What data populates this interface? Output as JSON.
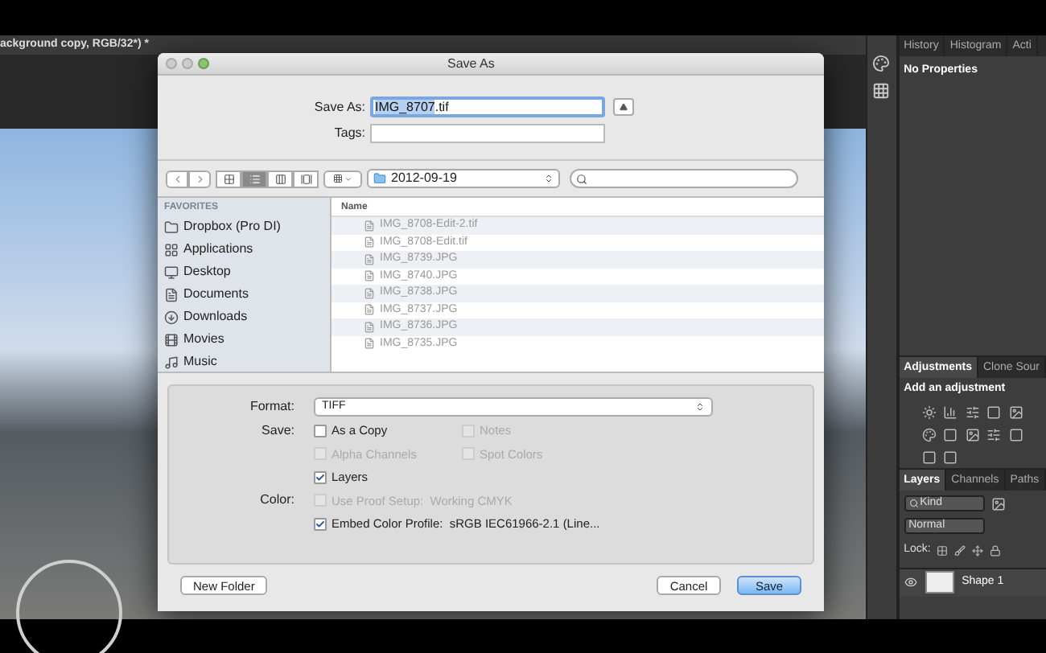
{
  "document_tab": {
    "title": "ackground copy, RGB/32*) *"
  },
  "dialog": {
    "title": "Save As",
    "save_as": {
      "label": "Save As:",
      "selected_text": "IMG_8707",
      "text_after": ".tif"
    },
    "tags": {
      "label": "Tags:"
    },
    "view_modes": [
      {
        "kind": "icons",
        "selected": false
      },
      {
        "kind": "list",
        "selected": true
      },
      {
        "kind": "columns",
        "selected": false
      },
      {
        "kind": "coverflow",
        "selected": false
      }
    ],
    "location": "2012-09-19",
    "sidebar": {
      "heading": "FAVORITES",
      "items": [
        {
          "label": "Dropbox (Pro DI)",
          "kind": "folder",
          "selected": false
        },
        {
          "label": "Applications",
          "kind": "apps",
          "selected": false
        },
        {
          "label": "Desktop",
          "kind": "desktop",
          "selected": false
        },
        {
          "label": "Documents",
          "kind": "documents",
          "selected": false
        },
        {
          "label": "Downloads",
          "kind": "downloads",
          "selected": false
        },
        {
          "label": "Movies",
          "kind": "movies",
          "selected": false
        },
        {
          "label": "Music",
          "kind": "music",
          "selected": false
        }
      ]
    },
    "files": {
      "column": "Name",
      "rows": [
        {
          "name": "IMG_8708-Edit-2.tif"
        },
        {
          "name": "IMG_8708-Edit.tif"
        },
        {
          "name": "IMG_8739.JPG"
        },
        {
          "name": "IMG_8740.JPG"
        },
        {
          "name": "IMG_8738.JPG"
        },
        {
          "name": "IMG_8737.JPG"
        },
        {
          "name": "IMG_8736.JPG"
        },
        {
          "name": "IMG_8735.JPG"
        }
      ]
    },
    "format": {
      "label": "Format:",
      "value": "TIFF"
    },
    "option_rows": [
      {
        "label": "Save:",
        "options": [
          {
            "label": "As a Copy",
            "checked": false,
            "disabled": false
          },
          {
            "label": "Notes",
            "checked": false,
            "disabled": true
          }
        ]
      },
      {
        "options": [
          {
            "label": "Alpha Channels",
            "checked": false,
            "disabled": true
          },
          {
            "label": "Spot Colors",
            "checked": false,
            "disabled": true
          }
        ]
      },
      {
        "options": [
          {
            "label": "Layers",
            "checked": true,
            "disabled": false
          }
        ]
      },
      {
        "label": "Color:",
        "options": [
          {
            "label": "Use Proof Setup:  Working CMYK",
            "checked": false,
            "disabled": true
          }
        ]
      },
      {
        "options": [
          {
            "label": "Embed Color Profile:  sRGB IEC61966-2.1 (Line...",
            "checked": true,
            "disabled": false
          }
        ]
      }
    ],
    "buttons": [
      {
        "label": "New Folder",
        "kind": "secondary"
      },
      {
        "label": "Cancel",
        "kind": "secondary"
      },
      {
        "label": "Save",
        "kind": "default"
      }
    ]
  },
  "panels": {
    "properties": {
      "tabs": [
        {
          "label": "History",
          "selected": false
        },
        {
          "label": "Histogram",
          "selected": false
        },
        {
          "label": "Acti",
          "selected": false
        }
      ],
      "message": "No Properties"
    },
    "adjustments": {
      "tabs": [
        {
          "label": "Adjustments",
          "selected": true
        },
        {
          "label": "Clone Sour",
          "selected": false
        }
      ],
      "heading": "Add an adjustment"
    },
    "layers": {
      "tabs": [
        {
          "label": "Layers",
          "selected": true
        },
        {
          "label": "Channels",
          "selected": false
        },
        {
          "label": "Paths",
          "selected": false
        }
      ],
      "filter": "Kind",
      "blend_mode": "Normal",
      "lock_label": "Lock:",
      "layer_name": "Shape 1"
    }
  }
}
